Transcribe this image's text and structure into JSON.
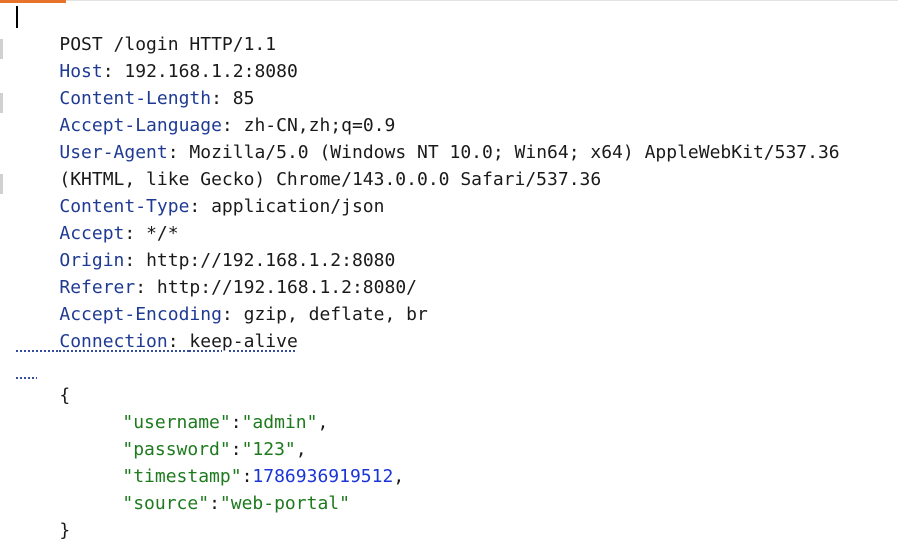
{
  "request": {
    "request_line": "POST /login HTTP/1.1",
    "headers": [
      {
        "name": "Host",
        "value": "192.168.1.2:8080"
      },
      {
        "name": "Content-Length",
        "value": "85"
      },
      {
        "name": "Accept-Language",
        "value": "zh-CN,zh;q=0.9"
      },
      {
        "name": "User-Agent",
        "value": "Mozilla/5.0 (Windows NT 10.0; Win64; x64) AppleWebKit/537.36"
      },
      {
        "name": "Content-Type",
        "value": "application/json"
      },
      {
        "name": "Accept",
        "value": "*/*"
      },
      {
        "name": "Origin",
        "value": "http://192.168.1.2:8080"
      },
      {
        "name": "Referer",
        "value": "http://192.168.1.2:8080/"
      },
      {
        "name": "Accept-Encoding",
        "value": "gzip, deflate, br"
      },
      {
        "name": "Connection",
        "value": "keep-alive"
      }
    ],
    "user_agent_continuation": "(KHTML, like Gecko) Chrome/143.0.0.0 Safari/537.36",
    "body": {
      "open_brace": "{",
      "close_brace": "}",
      "fields": [
        {
          "key": "\"username\"",
          "value": "\"admin\"",
          "suffix": ","
        },
        {
          "key": "\"password\"",
          "value": "\"123\"",
          "suffix": ","
        },
        {
          "key": "\"timestamp\"",
          "value": "1786936919512",
          "suffix": ","
        },
        {
          "key": "\"source\"",
          "value": "\"web-portal\"",
          "suffix": ""
        }
      ]
    },
    "header_separator": ": ",
    "json_colon": ":"
  },
  "colors": {
    "header_key": "#1f3a93",
    "json_string": "#1e7a1e",
    "json_number": "#1a35d6",
    "accent": "#e8742b"
  }
}
